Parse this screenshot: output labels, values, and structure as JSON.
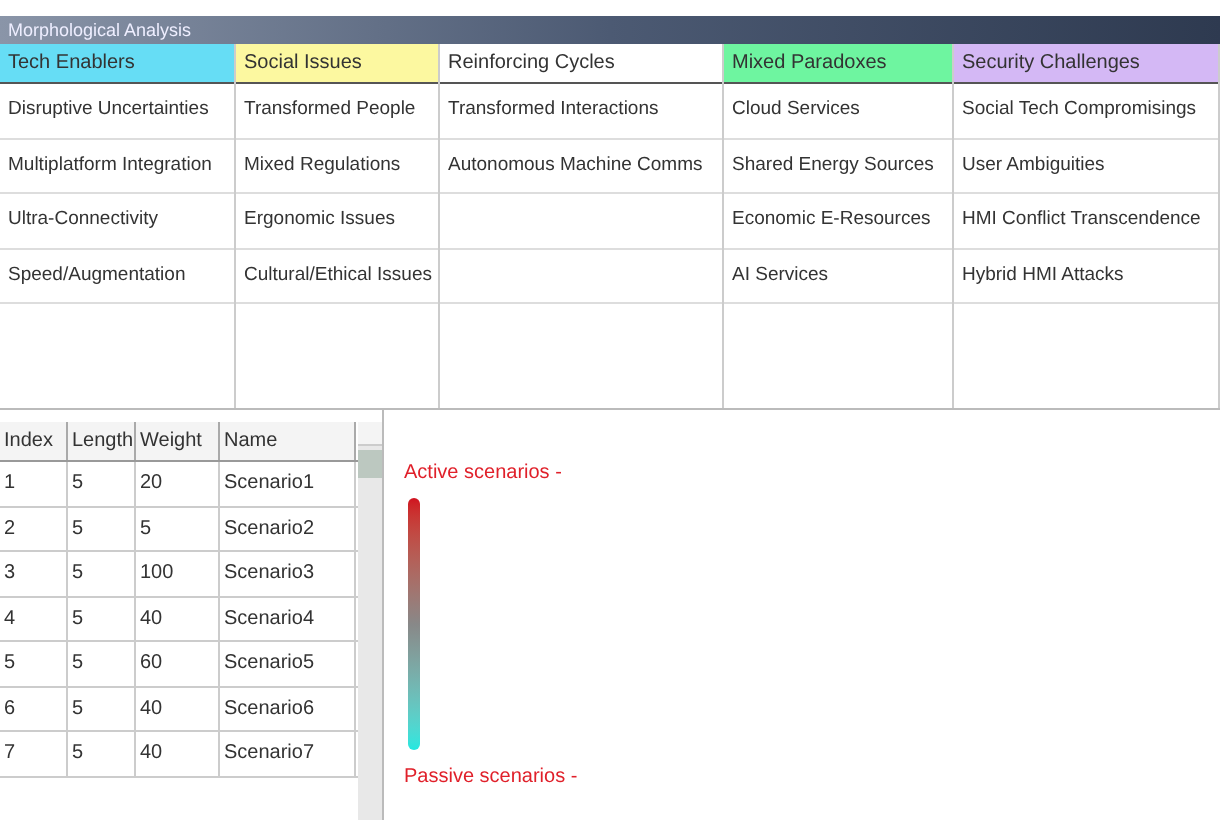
{
  "window": {
    "title": "Morphological Analysis"
  },
  "matrix": {
    "columns": [
      {
        "label": "Tech Enablers",
        "color": "#66ddf5",
        "cells": [
          "Disruptive Uncertainties",
          "Multiplatform Integration",
          "Ultra-Connectivity",
          "Speed/Augmentation"
        ]
      },
      {
        "label": "Social Issues",
        "color": "#fcf8a0",
        "cells": [
          "Transformed People",
          "Mixed Regulations",
          "Ergonomic Issues",
          "Cultural/Ethical Issues"
        ]
      },
      {
        "label": "Reinforcing Cycles",
        "color": "#ffffff",
        "cells": [
          "Transformed Interactions",
          "Autonomous Machine Comms"
        ]
      },
      {
        "label": "Mixed Paradoxes",
        "color": "#6ef5a0",
        "cells": [
          "Cloud Services",
          "Shared Energy Sources",
          "Economic E-Resources",
          "AI Services"
        ]
      },
      {
        "label": "Security Challenges",
        "color": "#d4b8f5",
        "cells": [
          "Social Tech Compromisings",
          "User Ambiguities",
          "HMI Conflict Transcendence",
          "Hybrid HMI Attacks"
        ]
      }
    ]
  },
  "scenarios": {
    "columns": [
      "Index",
      "Length",
      "Weight",
      "Name"
    ],
    "rows": [
      [
        "1",
        "5",
        "20",
        "Scenario1"
      ],
      [
        "2",
        "5",
        "5",
        "Scenario2"
      ],
      [
        "3",
        "5",
        "100",
        "Scenario3"
      ],
      [
        "4",
        "5",
        "40",
        "Scenario4"
      ],
      [
        "5",
        "5",
        "60",
        "Scenario5"
      ],
      [
        "6",
        "5",
        "40",
        "Scenario6"
      ],
      [
        "7",
        "5",
        "40",
        "Scenario7"
      ]
    ]
  },
  "legend": {
    "top": "Active scenarios -",
    "bottom": "Passive scenarios -"
  }
}
